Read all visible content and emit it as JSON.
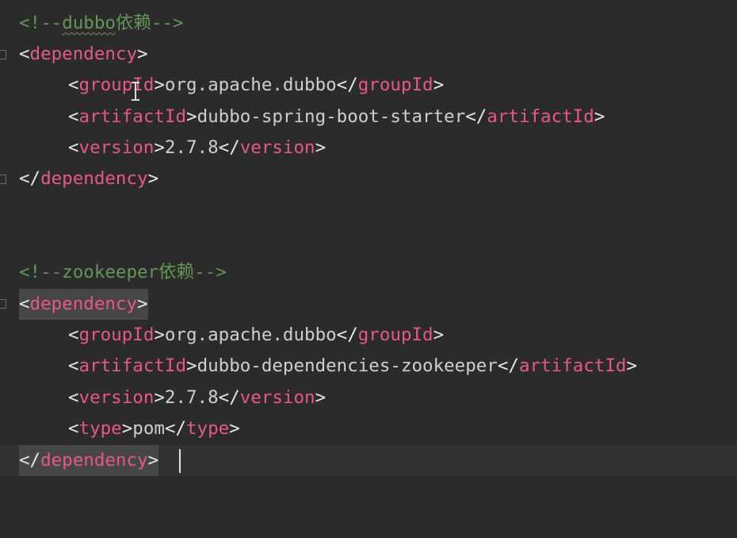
{
  "lines": {
    "c1": {
      "open": "<!--",
      "word": "dubbo",
      "rest": "依赖",
      "close": "-->"
    },
    "l1": {
      "lt": "<",
      "name": "dependency",
      "gt": ">"
    },
    "l2": {
      "lt": "<",
      "name": "groupId",
      "gt": ">",
      "value": "org.apache.dubbo",
      "clt": "</",
      "cname": "groupId",
      "cgt": ">"
    },
    "l3": {
      "lt": "<",
      "name": "artifactId",
      "gt": ">",
      "value": "dubbo-spring-boot-starter",
      "clt": "</",
      "cname": "artifactId",
      "cgt": ">"
    },
    "l4": {
      "lt": "<",
      "name": "version",
      "gt": ">",
      "value": "2.7.8",
      "clt": "</",
      "cname": "version",
      "cgt": ">"
    },
    "l5": {
      "clt": "</",
      "cname": "dependency",
      "cgt": ">"
    },
    "c2": {
      "text": "<!--zookeeper依赖-->"
    },
    "l6": {
      "lt": "<",
      "name": "dependency",
      "gt": ">"
    },
    "l7": {
      "lt": "<",
      "name": "groupId",
      "gt": ">",
      "value": "org.apache.dubbo",
      "clt": "</",
      "cname": "groupId",
      "cgt": ">"
    },
    "l8": {
      "lt": "<",
      "name": "artifactId",
      "gt": ">",
      "value": "dubbo-dependencies-zookeeper",
      "clt": "</",
      "cname": "artifactId",
      "cgt": ">"
    },
    "l9": {
      "lt": "<",
      "name": "version",
      "gt": ">",
      "value": "2.7.8",
      "clt": "</",
      "cname": "version",
      "cgt": ">"
    },
    "l10": {
      "lt": "<",
      "name": "type",
      "gt": ">",
      "value": "pom",
      "clt": "</",
      "cname": "type",
      "cgt": ">"
    },
    "l11": {
      "clt": "</",
      "cname": "dependency",
      "cgt": ">"
    }
  },
  "colors": {
    "background": "#2b2b2b",
    "comment": "#629755",
    "tag": "#e8578a",
    "text": "#cfcfcf",
    "current_line": "#323232"
  },
  "icons": [
    "fold-marker-icon",
    "text-cursor-icon",
    "caret-icon"
  ]
}
